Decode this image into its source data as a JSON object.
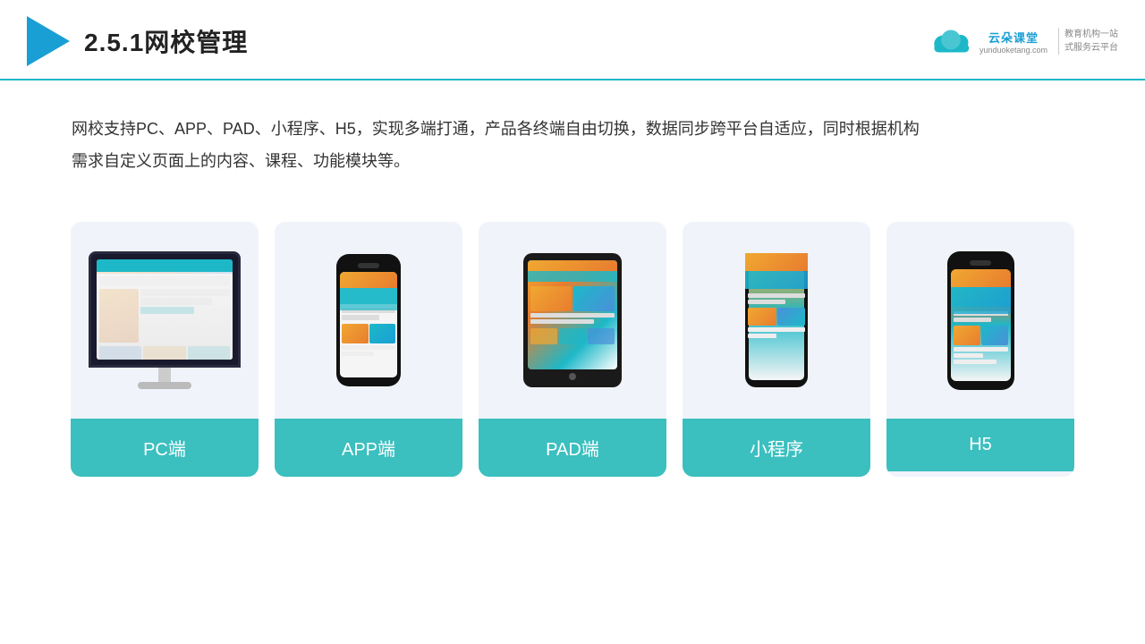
{
  "header": {
    "title": "2.5.1网校管理",
    "brand": {
      "name": "云朵课堂",
      "url": "yunduoketang.com",
      "slogan_line1": "教育机构一站",
      "slogan_line2": "式服务云平台"
    }
  },
  "description": {
    "text": "网校支持PC、APP、PAD、小程序、H5，实现多端打通，产品各终端自由切换，数据同步跨平台自适应，同时根据机构需求自定义页面上的内容、课程、功能模块等。"
  },
  "cards": [
    {
      "id": "pc",
      "label": "PC端",
      "type": "monitor"
    },
    {
      "id": "app",
      "label": "APP端",
      "type": "phone"
    },
    {
      "id": "pad",
      "label": "PAD端",
      "type": "tablet"
    },
    {
      "id": "miniprogram",
      "label": "小程序",
      "type": "phone"
    },
    {
      "id": "h5",
      "label": "H5",
      "type": "phone"
    }
  ],
  "colors": {
    "accent": "#1db8c8",
    "header_border": "#1db8c8",
    "triangle": "#1a9fd4",
    "card_label_bg": "#3bbfbf",
    "card_bg": "#f0f4fa"
  }
}
